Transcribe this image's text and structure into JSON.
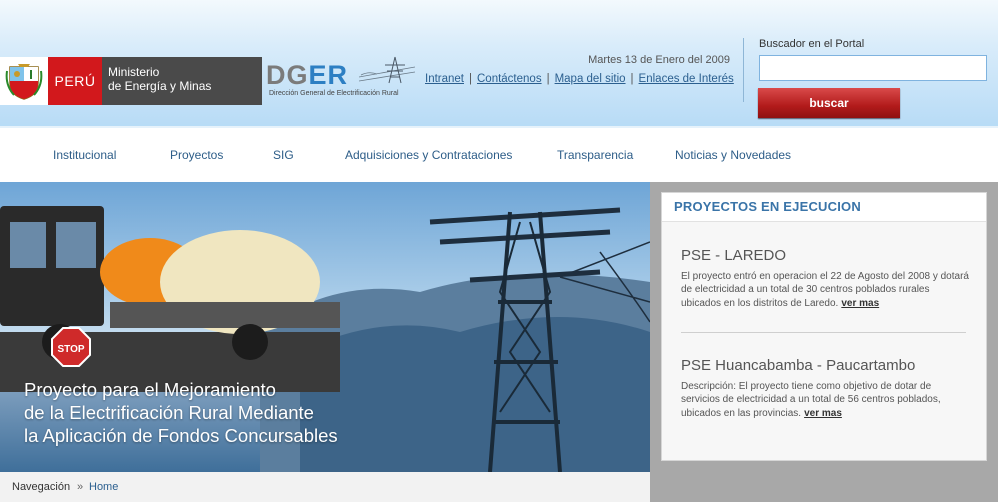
{
  "header": {
    "brand": {
      "country": "PERÚ",
      "ministry_line1": "Ministerio",
      "ministry_line2": "de Energía y Minas"
    },
    "dger": {
      "dg": "DG",
      "er": "ER",
      "subtitle": "Dirección General de Electrificación Rural"
    },
    "date": "Martes 13 de Enero del 2009",
    "links": [
      "Intranet",
      "Contáctenos",
      "Mapa del sitio",
      "Enlaces de Interés"
    ],
    "search": {
      "label": "Buscador en el Portal",
      "value": "",
      "placeholder": "",
      "button_label": "buscar"
    }
  },
  "nav": {
    "items": [
      "Institucional",
      "Proyectos",
      "SIG",
      "Adquisiciones y Contrataciones",
      "Transparencia",
      "Noticias y Novedades"
    ]
  },
  "hero": {
    "caption": [
      "Proyecto para el Mejoramiento",
      "de la Electrificación Rural Mediante",
      "la Aplicación de Fondos Concursables"
    ],
    "stop_sign": "STOP"
  },
  "breadcrumb": {
    "label": "Navegación",
    "separator": "»",
    "current": "Home"
  },
  "sidebar": {
    "title": "PROYECTOS EN EJECUCION",
    "projects": [
      {
        "title": "PSE - LAREDO",
        "text": "El proyecto entró en operacion el 22 de Agosto del 2008 y dotará de electricidad a un total de 30 centros poblados rurales ubicados en los distritos de Laredo.",
        "link": "ver mas"
      },
      {
        "title": "PSE Huancabamba - Paucartambo",
        "text": "Descripción: El proyecto tiene como objetivo de dotar de servicios de electricidad a un total de 56 centros poblados, ubicados en las provincias.",
        "link": "ver mas"
      }
    ]
  },
  "colors": {
    "brand_red": "#d2181c",
    "link_blue": "#2b5f8f",
    "panel_title": "#3a74a8"
  }
}
